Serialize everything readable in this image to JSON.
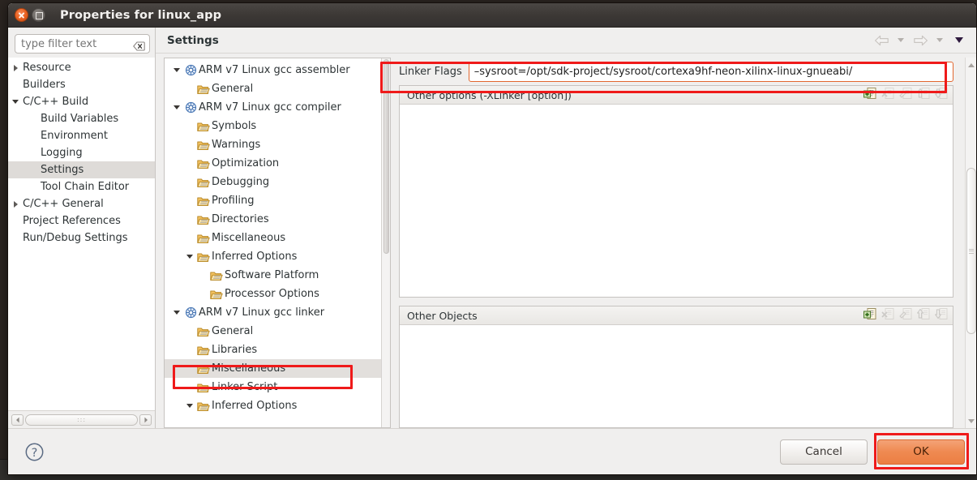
{
  "window": {
    "title": "Properties for linux_app",
    "close_icon": "close-icon",
    "maximize_icon": "maximize-icon"
  },
  "filter": {
    "placeholder": "type filter text",
    "value": "",
    "clear_icon": "clear-icon"
  },
  "left_nav": {
    "items": [
      {
        "label": "Resource",
        "indent": 0,
        "arrow": "right",
        "selected": false
      },
      {
        "label": "Builders",
        "indent": 0,
        "arrow": "none",
        "selected": false
      },
      {
        "label": "C/C++ Build",
        "indent": 0,
        "arrow": "down",
        "selected": false
      },
      {
        "label": "Build Variables",
        "indent": 1,
        "arrow": "none",
        "selected": false
      },
      {
        "label": "Environment",
        "indent": 1,
        "arrow": "none",
        "selected": false
      },
      {
        "label": "Logging",
        "indent": 1,
        "arrow": "none",
        "selected": false
      },
      {
        "label": "Settings",
        "indent": 1,
        "arrow": "none",
        "selected": true
      },
      {
        "label": "Tool Chain Editor",
        "indent": 1,
        "arrow": "none",
        "selected": false
      },
      {
        "label": "C/C++ General",
        "indent": 0,
        "arrow": "right",
        "selected": false
      },
      {
        "label": "Project References",
        "indent": 0,
        "arrow": "none",
        "selected": false
      },
      {
        "label": "Run/Debug Settings",
        "indent": 0,
        "arrow": "none",
        "selected": false
      }
    ]
  },
  "settings": {
    "title": "Settings",
    "nav": {
      "back_icon": "back-arrow-icon",
      "back_menu_icon": "chevron-down-icon",
      "forward_icon": "forward-arrow-icon",
      "forward_menu_icon": "chevron-down-icon",
      "view_menu_icon": "view-menu-chevron-icon"
    }
  },
  "tool_tree": {
    "items": [
      {
        "label": "ARM v7 Linux gcc assembler",
        "indent": 0,
        "arrow": "down",
        "icon": "tool-icon",
        "selected": false
      },
      {
        "label": "General",
        "indent": 1,
        "arrow": "none",
        "icon": "category-icon",
        "selected": false
      },
      {
        "label": "ARM v7 Linux gcc compiler",
        "indent": 0,
        "arrow": "down",
        "icon": "tool-icon",
        "selected": false
      },
      {
        "label": "Symbols",
        "indent": 1,
        "arrow": "none",
        "icon": "category-icon",
        "selected": false
      },
      {
        "label": "Warnings",
        "indent": 1,
        "arrow": "none",
        "icon": "category-icon",
        "selected": false
      },
      {
        "label": "Optimization",
        "indent": 1,
        "arrow": "none",
        "icon": "category-icon",
        "selected": false
      },
      {
        "label": "Debugging",
        "indent": 1,
        "arrow": "none",
        "icon": "category-icon",
        "selected": false
      },
      {
        "label": "Profiling",
        "indent": 1,
        "arrow": "none",
        "icon": "category-icon",
        "selected": false
      },
      {
        "label": "Directories",
        "indent": 1,
        "arrow": "none",
        "icon": "category-icon",
        "selected": false
      },
      {
        "label": "Miscellaneous",
        "indent": 1,
        "arrow": "none",
        "icon": "category-icon",
        "selected": false
      },
      {
        "label": "Inferred Options",
        "indent": 1,
        "arrow": "down",
        "icon": "category-icon",
        "selected": false
      },
      {
        "label": "Software Platform",
        "indent": 2,
        "arrow": "none",
        "icon": "category-icon",
        "selected": false
      },
      {
        "label": "Processor Options",
        "indent": 2,
        "arrow": "none",
        "icon": "category-icon",
        "selected": false
      },
      {
        "label": "ARM v7 Linux gcc linker",
        "indent": 0,
        "arrow": "down",
        "icon": "tool-icon",
        "selected": false
      },
      {
        "label": "General",
        "indent": 1,
        "arrow": "none",
        "icon": "category-icon",
        "selected": false
      },
      {
        "label": "Libraries",
        "indent": 1,
        "arrow": "none",
        "icon": "category-icon",
        "selected": false
      },
      {
        "label": "Miscellaneous",
        "indent": 1,
        "arrow": "none",
        "icon": "category-icon",
        "selected": true
      },
      {
        "label": "Linker Script",
        "indent": 1,
        "arrow": "none",
        "icon": "category-icon",
        "selected": false
      },
      {
        "label": "Inferred Options",
        "indent": 1,
        "arrow": "down",
        "icon": "category-icon",
        "selected": false
      }
    ]
  },
  "linker_flags": {
    "label": "Linker Flags",
    "value": "–sysroot=/opt/sdk-project/sysroot/cortexa9hf-neon-xilinx-linux-gnueabi/"
  },
  "other_options": {
    "title": "Other options (-XLinker [option])",
    "rows": [],
    "tools": [
      {
        "name": "add-icon",
        "enabled": true
      },
      {
        "name": "delete-icon",
        "enabled": false
      },
      {
        "name": "edit-icon",
        "enabled": false
      },
      {
        "name": "move-up-icon",
        "enabled": false
      },
      {
        "name": "move-down-icon",
        "enabled": false
      }
    ]
  },
  "other_objects": {
    "title": "Other Objects",
    "rows": [],
    "tools": [
      {
        "name": "add-icon",
        "enabled": true
      },
      {
        "name": "delete-icon",
        "enabled": false
      },
      {
        "name": "edit-icon",
        "enabled": false
      },
      {
        "name": "move-up-icon",
        "enabled": false
      },
      {
        "name": "move-down-icon",
        "enabled": false
      }
    ]
  },
  "footer": {
    "help_icon": "help-icon",
    "cancel_label": "Cancel",
    "ok_label": "OK"
  },
  "colors": {
    "highlight": "#ef1a1a",
    "primary_button": "#ef8a52",
    "selection": "#dedbd8",
    "field_border": "#e2672f"
  }
}
